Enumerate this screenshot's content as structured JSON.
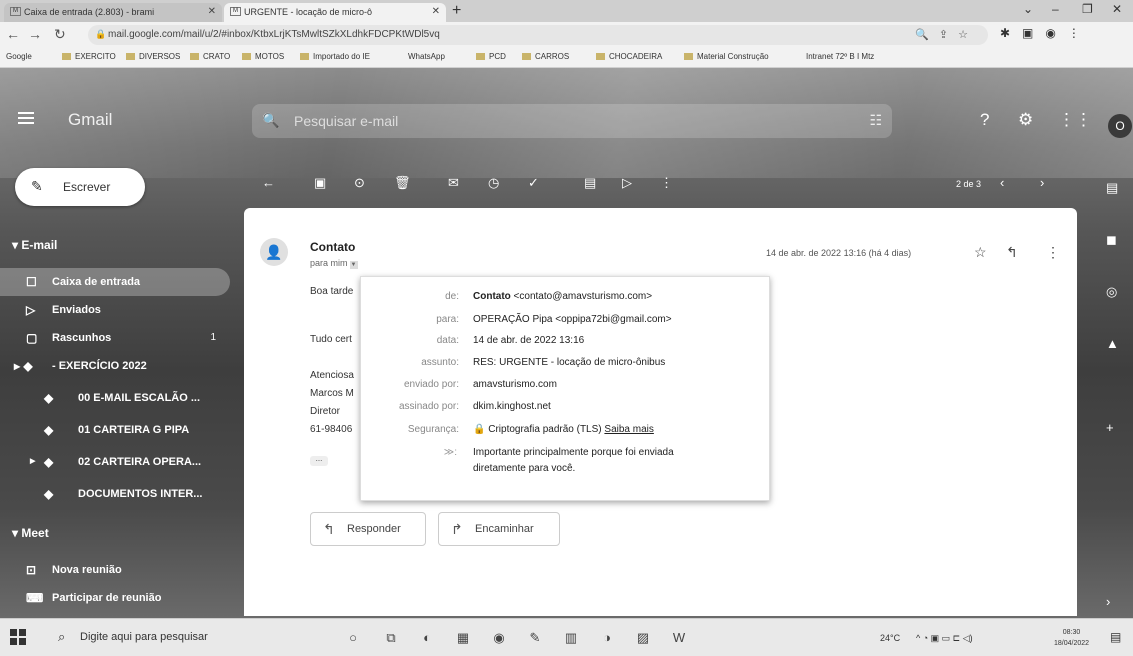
{
  "browser": {
    "tabs": [
      {
        "favicon": "M",
        "title": "Caixa de entrada (2.803) - brami"
      },
      {
        "favicon": "M",
        "title": "URGENTE - locação de micro-ô"
      }
    ],
    "url": "mail.google.com/mail/u/2/#inbox/KtbxLrjKTsMwltSZkXLdhkFDCPKtWDl5vq",
    "bookmarks": [
      "Google",
      "EXERCITO",
      "DIVERSOS",
      "CRATO",
      "MOTOS",
      "Importado do IE",
      "WhatsApp",
      "PCD",
      "CARROS",
      "CHOCADEIRA",
      "Material Construção",
      "Intranet 72º B I Mtz"
    ]
  },
  "gmail": {
    "logo": "Gmail",
    "search_placeholder": "Pesquisar e-mail",
    "compose_label": "Escrever",
    "avatar_letter": "O",
    "pager": "2 de 3"
  },
  "sidebar": {
    "email_section": "E-mail",
    "items": [
      {
        "icon": "inbox-icon",
        "label": "Caixa de entrada",
        "count": ""
      },
      {
        "icon": "send-icon",
        "label": "Enviados",
        "count": ""
      },
      {
        "icon": "draft-icon",
        "label": "Rascunhos",
        "count": "1"
      },
      {
        "icon": "label-icon",
        "label": "- EXERCÍCIO 2022",
        "count": ""
      }
    ],
    "sublabels": [
      "00 E-MAIL ESCALÃO ...",
      "01 CARTEIRA G PIPA",
      "02 CARTEIRA OPERA...",
      "DOCUMENTOS INTER..."
    ],
    "meet_section": "Meet",
    "meet_items": [
      "Nova reunião",
      "Participar de reunião"
    ]
  },
  "message": {
    "sender": "Contato",
    "to_summary": "para mim",
    "date": "14 de abr. de 2022 13:16 (há 4 dias)",
    "body_lines": [
      "Boa tarde",
      "Tudo cert",
      "Atenciosa",
      "Marcos M",
      "Diretor",
      "61-98406"
    ],
    "reply_label": "Responder",
    "forward_label": "Encaminhar"
  },
  "details": {
    "rows": [
      {
        "key": "de:",
        "value_bold": "Contato",
        "value": " <contato@amavsturismo.com>"
      },
      {
        "key": "para:",
        "value_bold": "",
        "value": "OPERAÇÃO Pipa <oppipa72bi@gmail.com>"
      },
      {
        "key": "data:",
        "value_bold": "",
        "value": "14 de abr. de 2022 13:16"
      },
      {
        "key": "assunto:",
        "value_bold": "",
        "value": "RES: URGENTE - locação de micro-ônibus"
      },
      {
        "key": "enviado por:",
        "value_bold": "",
        "value": "amavsturismo.com"
      },
      {
        "key": "assinado por:",
        "value_bold": "",
        "value": "dkim.kinghost.net"
      }
    ],
    "security_key": "Segurança:",
    "security_value": "Criptografia padrão (TLS)",
    "security_link": "Saiba mais",
    "importance_line1": "Importante principalmente porque foi enviada",
    "importance_line2": "diretamente para você."
  },
  "taskbar": {
    "search_placeholder": "Digite aqui para pesquisar",
    "temperature": "24°C",
    "time": "08:30",
    "date": "18/04/2022"
  }
}
